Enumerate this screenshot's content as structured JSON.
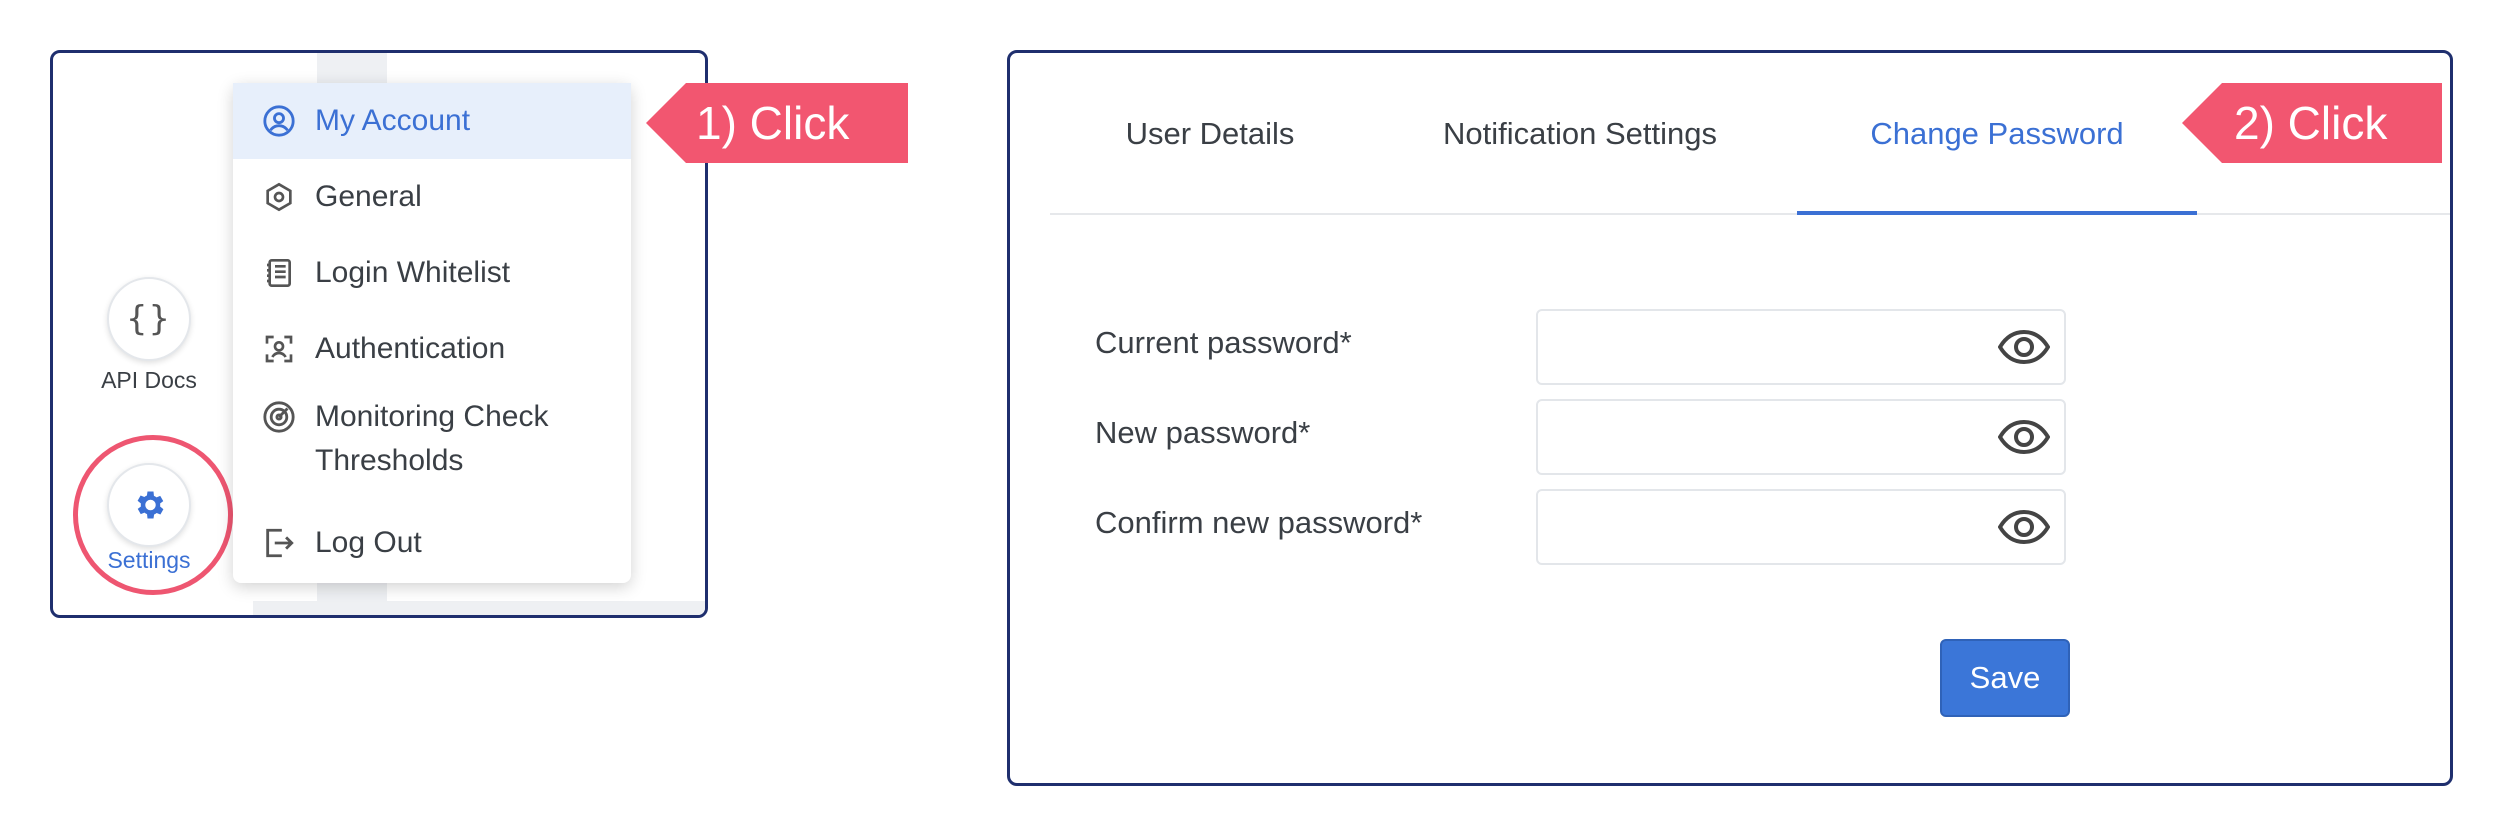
{
  "left_panel": {
    "sidebar": {
      "api_docs": {
        "icon": "curly-braces-icon",
        "glyph": "{}",
        "label": "API Docs"
      },
      "settings": {
        "icon": "gear-icon",
        "label": "Settings"
      }
    },
    "menu": {
      "items": [
        {
          "label": "My Account",
          "icon": "user-circle-icon",
          "active": true
        },
        {
          "label": "General",
          "icon": "hexagon-icon",
          "active": false
        },
        {
          "label": "Login Whitelist",
          "icon": "notebook-list-icon",
          "active": false
        },
        {
          "label": "Authentication",
          "icon": "face-scan-icon",
          "active": false
        },
        {
          "label": "Monitoring Check Thresholds",
          "icon": "target-gauge-icon",
          "active": false
        },
        {
          "label": "Log Out",
          "icon": "logout-icon",
          "active": false
        }
      ]
    },
    "callout": "1) Click"
  },
  "right_panel": {
    "tabs": [
      {
        "label": "User Details",
        "active": false
      },
      {
        "label": "Notification Settings",
        "active": false
      },
      {
        "label": "Change Password",
        "active": true
      }
    ],
    "callout": "2) Click",
    "form": {
      "fields": [
        {
          "label": "Current password*",
          "value": "",
          "icon": "eye-icon"
        },
        {
          "label": "New password*",
          "value": "",
          "icon": "eye-icon"
        },
        {
          "label": "Confirm new password*",
          "value": "",
          "icon": "eye-icon"
        }
      ],
      "save_label": "Save"
    }
  },
  "colors": {
    "accent": "#3b70d4",
    "callout": "#f25670",
    "frame": "#1f2f6e",
    "active_bg": "#e7effb"
  }
}
